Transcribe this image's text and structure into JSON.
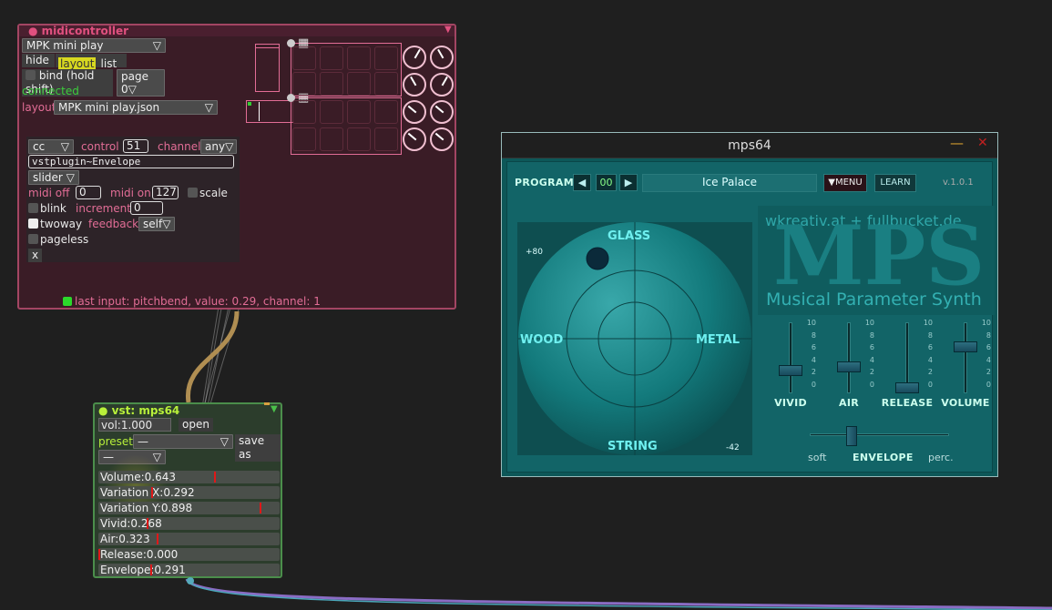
{
  "midicontroller": {
    "title": "midicontroller",
    "device": "MPK mini play",
    "hide_label": "hide",
    "layout_tab": "layout",
    "list_tab": "list",
    "bind_label": "bind (hold shift)",
    "page_select": "page 0",
    "status": "connected",
    "layout_label": "layout",
    "layout_file": "MPK mini play.json",
    "mapping": {
      "type": "cc",
      "control_label": "control",
      "control_value": "51",
      "channel_label": "channel",
      "channel_value": "any",
      "target": "vstplugin~Envelope",
      "widget": "slider",
      "midi_off_label": "midi off",
      "midi_off_value": "0",
      "midi_on_label": "midi on",
      "midi_on_value": "127",
      "scale_label": "scale",
      "blink_label": "blink",
      "increment_label": "increment",
      "increment_value": "0",
      "twoway_label": "twoway",
      "feedback_label": "feedback",
      "feedback_value": "self",
      "pageless_label": "pageless",
      "close_label": "x"
    },
    "last_input": "last input: pitchbend, value: 0.29, channel: 1"
  },
  "vst_node": {
    "title": "vst: mps64",
    "vol_label": "vol:",
    "vol_value": "1.000",
    "open_label": "open",
    "preset_label": "preset",
    "preset_value": "—",
    "save_as_label": "save as",
    "second_select": "—",
    "params": [
      {
        "name": "Volume",
        "value": "0.643",
        "level": 0.643
      },
      {
        "name": "Variation X",
        "value": "0.292",
        "level": 0.292
      },
      {
        "name": "Variation Y",
        "value": "0.898",
        "level": 0.898
      },
      {
        "name": "Vivid",
        "value": "0.268",
        "level": 0.268
      },
      {
        "name": "Air",
        "value": "0.323",
        "level": 0.323
      },
      {
        "name": "Release",
        "value": "0.000",
        "level": 0.0
      },
      {
        "name": "Envelope",
        "value": "0.291",
        "level": 0.291
      }
    ]
  },
  "plugin": {
    "window_title": "mps64",
    "program_label": "PROGRAM",
    "program_number": "00",
    "program_name": "Ice Palace",
    "menu_label": "▼MENU",
    "learn_label": "LEARN",
    "version": "v.1.0.1",
    "sphere": {
      "top": "GLASS",
      "left": "WOOD",
      "right": "METAL",
      "bottom": "STRING",
      "plus": "+80",
      "minus": "-42"
    },
    "brand": "wkreativ.at + fullbucket.de",
    "logo": "MPS",
    "subtitle": "Musical Parameter Synth",
    "faders": [
      {
        "label": "VIVID",
        "level": 0.268
      },
      {
        "label": "AIR",
        "level": 0.323
      },
      {
        "label": "RELEASE",
        "level": 0.0
      },
      {
        "label": "VOLUME",
        "level": 0.643
      }
    ],
    "fader_ticks": [
      "10",
      "8",
      "6",
      "4",
      "2",
      "0"
    ],
    "envelope_label": "ENVELOPE",
    "soft_label": "soft",
    "perc_label": "perc.",
    "envelope_level": 0.291
  },
  "colors": {
    "accent_pink": "#e0507f",
    "accent_green": "#b8f03a",
    "plugin_teal": "#126467"
  }
}
